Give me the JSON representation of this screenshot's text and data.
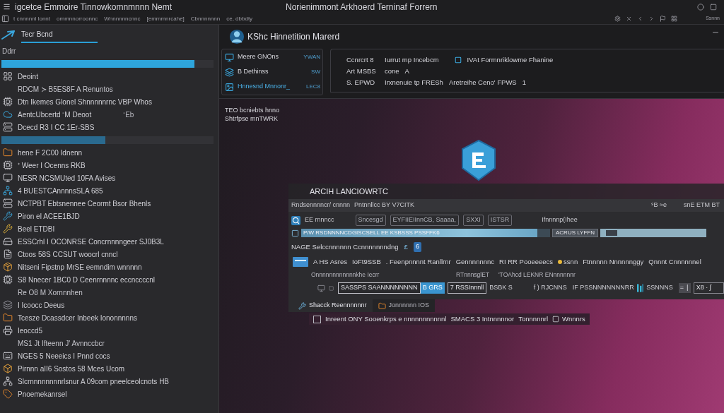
{
  "window": {
    "title": "igcetce Emmoire Tinnowkomnmnnn Nemt",
    "subtitle": "Norienimmont Arkhoerd Terninaf Forrern",
    "account": "Ssnnn"
  },
  "menu": [
    {
      "label": "t cnnnnnl lonnt"
    },
    {
      "label": "ommnnorroonnc"
    },
    {
      "label": "Wnnnnnncnnc"
    },
    {
      "label": "[emmmnrcahe]"
    },
    {
      "label": "Cbnnnnnnn"
    },
    {
      "label": "ce, dbbdty"
    }
  ],
  "sidebar": {
    "title": "Tecr Bcnd",
    "items": [
      {
        "kind": "heading",
        "label": "Ddrr"
      },
      {
        "kind": "bar",
        "level": 0.91
      },
      {
        "kind": "item",
        "label": "Deoint"
      },
      {
        "kind": "sub",
        "label": "RDCM ≻ B5ES8F A Renuntos"
      },
      {
        "kind": "item",
        "label": "Dtn   Ikemes Glonel Shnnnnnrnc  VBP Whos"
      },
      {
        "kind": "item",
        "label": "AentcUbcertd  ⁻M  Deoot",
        "right": "⁻Eb"
      },
      {
        "kind": "item",
        "label": "Dcecd R3 I  CC 1Er-SBS"
      },
      {
        "kind": "bar",
        "level": 0.49
      },
      {
        "kind": "item",
        "label": "hene F 2C00 Idnenn"
      },
      {
        "kind": "item",
        "label": "⁺ Weer I Ocenns  RKB"
      },
      {
        "kind": "item",
        "label": "NESR NCSMUted 10FA Avises"
      },
      {
        "kind": "item",
        "label": "4 BUESTCAnnnnsSLA 685"
      },
      {
        "kind": "item",
        "label": "NCTPBT Ebtsnennee Ceormt Bsor Bhenls"
      },
      {
        "kind": "item",
        "label": "Piron el ACEE1BJD"
      },
      {
        "kind": "item",
        "label": "Beel ETDBI"
      },
      {
        "kind": "item",
        "label": "ESSCrhl I OCONRSE  Concrnnnngeer SJ0B3L"
      },
      {
        "kind": "item",
        "label": "Ctoos 58S CCSUT  woocrl cnncl"
      },
      {
        "kind": "item",
        "label": "Nitseni Fipstnp MrSE eemndim wnnnnn"
      },
      {
        "kind": "item",
        "label": "S8 Nnecer  1BC0 D Ceenrnnnnc eccnccccnl"
      },
      {
        "kind": "sub",
        "label": "Re O8 M Xornnnhen"
      },
      {
        "kind": "item",
        "label": "I Icoocc Deeus"
      },
      {
        "kind": "item",
        "label": "Tcesze Dcassdcer Inbeek Iononnnnns"
      },
      {
        "kind": "item",
        "label": "Ieoccd5"
      },
      {
        "kind": "sub",
        "label": "MS1 Jt  Ifteenn J' Avnnccbcr"
      },
      {
        "kind": "item",
        "label": "NGES 5 Neeeics I Pnnd cocs"
      },
      {
        "kind": "item",
        "label": "Pirnnn aII6 Sostos 58 Mces Ucom"
      },
      {
        "kind": "item",
        "label": "Slcrnnnnnnnnrlsnur A 09com pneelceolcnots HB"
      },
      {
        "kind": "item",
        "label": "Pnoemekanrsel"
      }
    ]
  },
  "panel": {
    "title": "KShc Hinnetition Marerd",
    "nav": [
      {
        "label": "Meere GNOns",
        "value": "YWAN",
        "selected": false
      },
      {
        "label": "B Dethinss",
        "value": "SW",
        "selected": false
      },
      {
        "label": "Hnnesnd Mnnonr_",
        "value": "LEC8",
        "selected": true
      }
    ],
    "details": [
      {
        "cells": [
          "Ccnrcrt 8",
          "Iurrut mp Incebcm"
        ],
        "note": "IVAt Formnriklowme Fhanine"
      },
      {
        "cells": [
          "Art MSBS",
          "cone",
          "A"
        ]
      },
      {
        "cells": [
          "S. EPWD",
          "Irxnenuie tp FRESh",
          "Aretreihe Ceno' FPWS",
          "1"
        ]
      }
    ]
  },
  "canvas": {
    "caption": "TEO bcniebts hnno",
    "caption_2": "Shtrfpse mnTWRK"
  },
  "dialog": {
    "title": "ARCIH LANCIOWRTC",
    "path": "Rndsennnncr/ cnnnn",
    "path_2": "Pntnnllcc BY V7CITK",
    "tools": [
      {
        "label": "⁹B ≈e"
      },
      {
        "label": "snE ETM BT"
      }
    ],
    "filters": [
      {
        "kind": "text",
        "label": "EE rnnncc"
      },
      {
        "kind": "chip",
        "label": "Sncesgd"
      },
      {
        "kind": "chip",
        "label": "EYFIIEIInnCB, Saaaa,"
      },
      {
        "kind": "chip",
        "label": "SXXI"
      },
      {
        "kind": "chip",
        "label": "ISTSR"
      },
      {
        "kind": "text",
        "label": "Ifnnnnp(Ihee"
      }
    ],
    "progress": {
      "label": "P/W  RSDNNNNCDGISCSELL  EE  KSBSSS PSSFFK6",
      "level": 0.95,
      "tag": "ACRUS LYFFN"
    },
    "slider": {
      "level": 0.06
    },
    "section": {
      "label": "NAGE Selccnnnnnn Ccnnnnnnndng",
      "mark": "£",
      "badge": "6"
    },
    "columns": [
      {
        "kind": "text",
        "label": "A HS Asres"
      },
      {
        "kind": "text",
        "label": "IoFt9SSB"
      },
      {
        "kind": "text",
        "label": ". Feenpnnnnt Ranllrnr"
      },
      {
        "kind": "text",
        "label": "Gennnnnnnc"
      },
      {
        "kind": "text",
        "label": "RI RR Pooeeeecs"
      },
      {
        "kind": "dot",
        "label": "ssnn"
      },
      {
        "kind": "text",
        "label": "Ftnnnnn Nnnnnnggy"
      },
      {
        "kind": "text",
        "label": "Qnnnt Cnnnnnnel"
      }
    ],
    "caption": "Onnnnnnnnnnnnkhe Iecrr",
    "labels": [
      "RTnnnsglET",
      "'TOAhcd LEKNR ENnnnnnnr"
    ],
    "form": {
      "input": "SASSPS   SAANNNNNNNN",
      "button": "B GRS",
      "box": "7 RSSInnnll",
      "note": "BSBK S",
      "items": [
        "f ) RJCNNS",
        "IF PSSNNNNNNNRR"
      ],
      "tag": "SSNNNS",
      "small_button": "= ∣",
      "combo": "X8 · ʃ"
    },
    "tabs": [
      {
        "label": "Shacck Reennnnnnr",
        "selected": true
      },
      {
        "label": "Jonnnnnn IOS",
        "selected": false
      }
    ]
  },
  "statusline": {
    "checked": false,
    "parts": [
      "Inreent ONY Sooenkrps e nnnnnnnnnnnl",
      "SMACS 3 Intnnnnnor",
      "Tonnnnnrl",
      "Wnnnrs"
    ]
  }
}
